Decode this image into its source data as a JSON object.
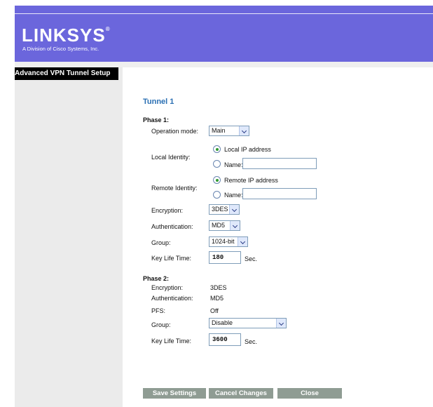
{
  "brand": {
    "logo": "LINKSYS",
    "logo_mark": "®",
    "tagline": "A Division of Cisco Systems, Inc."
  },
  "sidebar": {
    "title": "Advanced VPN Tunnel Setup"
  },
  "tunnel": {
    "title": "Tunnel 1"
  },
  "phase1": {
    "heading": "Phase 1:",
    "operation_mode": {
      "label": "Operation mode:",
      "value": "Main"
    },
    "local_identity": {
      "label": "Local Identity:",
      "option_ip": "Local IP address",
      "option_name": "Name:",
      "selected": "ip",
      "name_value": ""
    },
    "remote_identity": {
      "label": "Remote Identity:",
      "option_ip": "Remote IP address",
      "option_name": "Name:",
      "selected": "ip",
      "name_value": ""
    },
    "encryption": {
      "label": "Encryption:",
      "value": "3DES"
    },
    "authentication": {
      "label": "Authentication:",
      "value": "MD5"
    },
    "group": {
      "label": "Group:",
      "value": "1024-bit"
    },
    "key_life": {
      "label": "Key Life Time:",
      "value": "180",
      "unit": "Sec."
    }
  },
  "phase2": {
    "heading": "Phase 2:",
    "encryption": {
      "label": "Encryption:",
      "value": "3DES"
    },
    "authentication": {
      "label": "Authentication:",
      "value": "MD5"
    },
    "pfs": {
      "label": "PFS:",
      "value": "Off"
    },
    "group": {
      "label": "Group:",
      "value": "Disable"
    },
    "key_life": {
      "label": "Key Life Time:",
      "value": "3600",
      "unit": "Sec."
    }
  },
  "buttons": {
    "save": "Save Settings",
    "cancel": "Cancel Changes",
    "close": "Close"
  },
  "colors": {
    "header": "#6b66dc",
    "tunnel_title": "#2a6fb3",
    "button": "#8f9c93",
    "sidebar": "#ebebeb"
  }
}
